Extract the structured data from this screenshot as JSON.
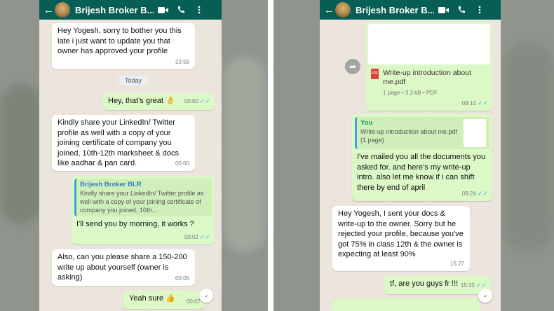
{
  "left": {
    "header": {
      "name": "Brijesh Broker B..."
    },
    "messages": {
      "m1": {
        "text": "Hey Yogesh, sorry to bother you this late i just want to update you that owner has approved your profile",
        "time": "23:59"
      },
      "date": "Today",
      "m2": {
        "text": "Hey, that's great",
        "emoji": "👌",
        "time": "00:00"
      },
      "m3": {
        "text": "Kindly share your LinkedIn/ Twitter profile as well with a copy of your joining certificate of company you joined, 10th-12th marksheet & docs like aadhar & pan card.",
        "time": "00:00"
      },
      "m4": {
        "quote_author": "Brijesh Broker BLR",
        "quote_text": "Kindly share your LinkedIn/ Twitter profile as well with a copy of your joining certificate of company you joined, 10th...",
        "text": "I'll send you by morning, it works ?",
        "time": "00:02"
      },
      "m5": {
        "text": "Also, can you please share a 150-200 write up about yourself (owner is asking)",
        "time": "00:05"
      },
      "m6": {
        "text": "Yeah sure",
        "emoji": "👍",
        "time": "00:07"
      }
    }
  },
  "right": {
    "header": {
      "name": "Brijesh Broker B..."
    },
    "messages": {
      "pdf": {
        "name": "Write-up introduction about me.pdf",
        "meta": "1 page • 3.3 kB • PDF",
        "icon_label": "PDF",
        "time": "09:10"
      },
      "m2": {
        "quote_author": "You",
        "quote_text": "Write-up introduction about me.pdf (1 page)",
        "text": "I've mailed you all the documents you asked for. and here's my write-up intro. also let me know if i can shift there by end of april",
        "time": "09:24"
      },
      "m3": {
        "text": "Hey Yogesh, I sent your docs & write-up to the owner. Sorry but he rejected your profile, because you've got 75% in class 12th & the owner is expecting at least 90%",
        "time": "15:27"
      },
      "m4": {
        "text": "tf, are you guys fr !!!",
        "time": "15:32"
      }
    }
  },
  "colors": {
    "header": "#075e54",
    "outgoing": "#dcf8c6",
    "incoming": "#ffffff",
    "read_tick": "#34b7f1"
  }
}
